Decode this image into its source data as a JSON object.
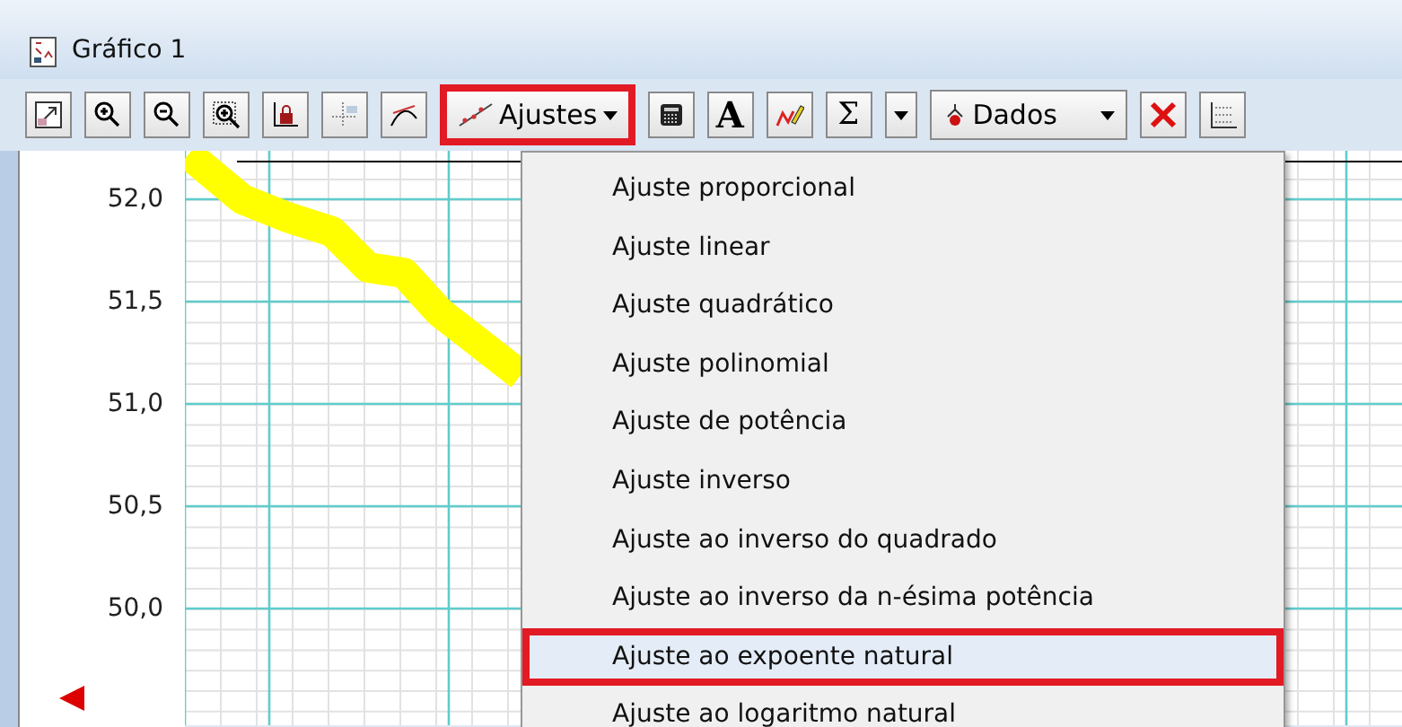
{
  "window": {
    "title": "Gráfico 1"
  },
  "toolbar": {
    "fit_menu": {
      "label": "Ajustes",
      "highlighted": true
    },
    "text_tool": "A",
    "sum_tool": "Σ",
    "data_menu": {
      "label": "Dados"
    }
  },
  "graph": {
    "y_labels": [
      "52,0",
      "51,5",
      "51,0",
      "50,5",
      "50,0"
    ]
  },
  "fit_menu_items": [
    {
      "label": "Ajuste proporcional",
      "selected": false,
      "highlighted": false
    },
    {
      "label": "Ajuste linear",
      "selected": false,
      "highlighted": false
    },
    {
      "label": "Ajuste quadrático",
      "selected": false,
      "highlighted": false
    },
    {
      "label": "Ajuste polinomial",
      "selected": false,
      "highlighted": false
    },
    {
      "label": "Ajuste de potência",
      "selected": false,
      "highlighted": false
    },
    {
      "label": "Ajuste inverso",
      "selected": false,
      "highlighted": false
    },
    {
      "label": "Ajuste ao inverso do quadrado",
      "selected": false,
      "highlighted": false
    },
    {
      "label": "Ajuste ao inverso da n-ésima potência",
      "selected": false,
      "highlighted": false
    },
    {
      "label": "Ajuste ao expoente natural",
      "selected": true,
      "highlighted": true
    },
    {
      "label": "Ajuste ao logaritmo natural",
      "selected": false,
      "highlighted": false
    }
  ]
}
